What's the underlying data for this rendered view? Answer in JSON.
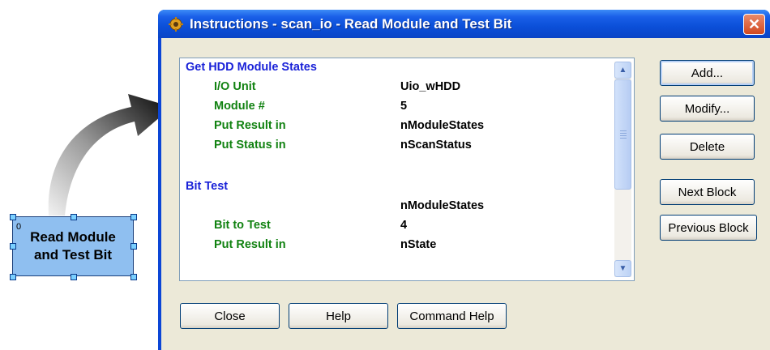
{
  "block": {
    "number": "0",
    "line1": "Read Module",
    "line2": "and Test Bit"
  },
  "window": {
    "title": "Instructions - scan_io - Read Module and Test Bit",
    "close_glyph": "✕"
  },
  "instructions": {
    "section1": {
      "heading": "Get HDD Module States",
      "rows": [
        {
          "label": "I/O Unit",
          "value": "Uio_wHDD"
        },
        {
          "label": "Module #",
          "value": "5"
        },
        {
          "label": "Put Result in",
          "value": "nModuleStates"
        },
        {
          "label": "Put Status in",
          "value": "nScanStatus"
        }
      ]
    },
    "section2": {
      "heading": "Bit Test",
      "rows": [
        {
          "label": "",
          "value": "nModuleStates"
        },
        {
          "label": "Bit to Test",
          "value": "4"
        },
        {
          "label": "Put Result in",
          "value": "nState"
        }
      ]
    }
  },
  "buttons": {
    "add": "Add...",
    "modify": "Modify...",
    "delete": "Delete",
    "next_block": "Next Block",
    "previous_block": "Previous Block",
    "close": "Close",
    "help": "Help",
    "command_help": "Command Help"
  },
  "icons": {
    "title": "instructions-gear-icon",
    "close": "close-icon",
    "scroll_up": "scroll-up-arrow-icon",
    "scroll_down": "scroll-down-arrow-icon"
  },
  "colors": {
    "heading": "#1a22d8",
    "label": "#118211",
    "titlebar": "#0b4fd8",
    "block_fill": "#8fbff0"
  }
}
